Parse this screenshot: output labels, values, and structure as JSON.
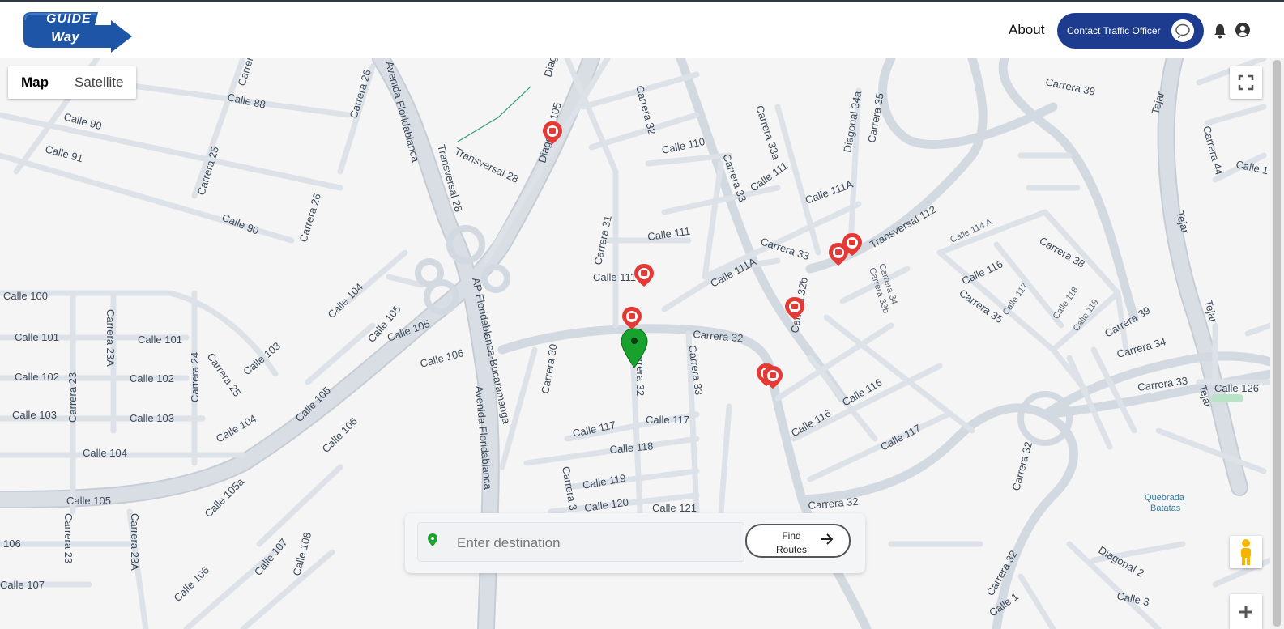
{
  "header": {
    "logo_line1": "GUIDE",
    "logo_line2": "Way",
    "about_label": "About",
    "contact_label": "Contact Traffic Officer",
    "icons": [
      "bell-icon",
      "account-circle-icon",
      "chat-bubble-icon"
    ]
  },
  "map": {
    "type_controls": {
      "map_label": "Map",
      "satellite_label": "Satellite",
      "active": "Map"
    },
    "street_labels": [
      "Calle 88",
      "Calle 90",
      "Calle 91",
      "Carrera 25",
      "Carrera 26",
      "Avenida Floridablanca",
      "Transversal 28",
      "Transversal 28",
      "Diagonal 105",
      "Carrera 32",
      "Calle 110",
      "Carrera 33",
      "Carrera 33a",
      "Calle 111",
      "Calle 111A",
      "Diagonal 34a",
      "Carrera 35",
      "Transversal 112",
      "Carrera 39",
      "Tejar",
      "Carrera 44",
      "Calle 1",
      "Calle 100",
      "Calle 101",
      "Carrera 23A",
      "Calle 102",
      "Calle 103",
      "Calle 104",
      "Calle 105",
      "Carrera 23",
      "Carrera 24",
      "Calle 106",
      "Calle 107",
      "Calle 105a",
      "Carrera 31",
      "Calle 111",
      "Calle 111A",
      "Carrera 33",
      "Carrera 32b",
      "Carrera 34",
      "Carrera 33b",
      "Calle 114 A",
      "Calle 116",
      "Carrera 38",
      "Calle 117",
      "Calle 118",
      "Calle 119",
      "Carrera 35",
      "Carrera 39",
      "Carrera 34",
      "Carrera 33",
      "Calle 126",
      "AP Floridablanca-Bucaramanga",
      "Carrera 30",
      "Carrera 32",
      "Calle 117",
      "Calle 118",
      "Calle 119",
      "Calle 120",
      "Calle 121",
      "Calle 116",
      "Calle 117",
      "Carrera 32",
      "Quebrada Batatas",
      "Diagonal 2",
      "Calle 3",
      "Calle 1",
      "Calle 108",
      "Calle 106"
    ],
    "markers": {
      "current_location": "green-location-pin-icon",
      "incident": "traffic-incident-marker-icon"
    },
    "colors": {
      "road": "#d2d8df",
      "road_edge": "#c3cad2",
      "background": "#f5f5f5",
      "brand": "#1d3c8f",
      "incident": "#e53935",
      "location": "#19a12e"
    }
  },
  "search": {
    "placeholder": "Enter destination",
    "value": "",
    "find_line1": "Find",
    "find_line2": "Routes"
  }
}
